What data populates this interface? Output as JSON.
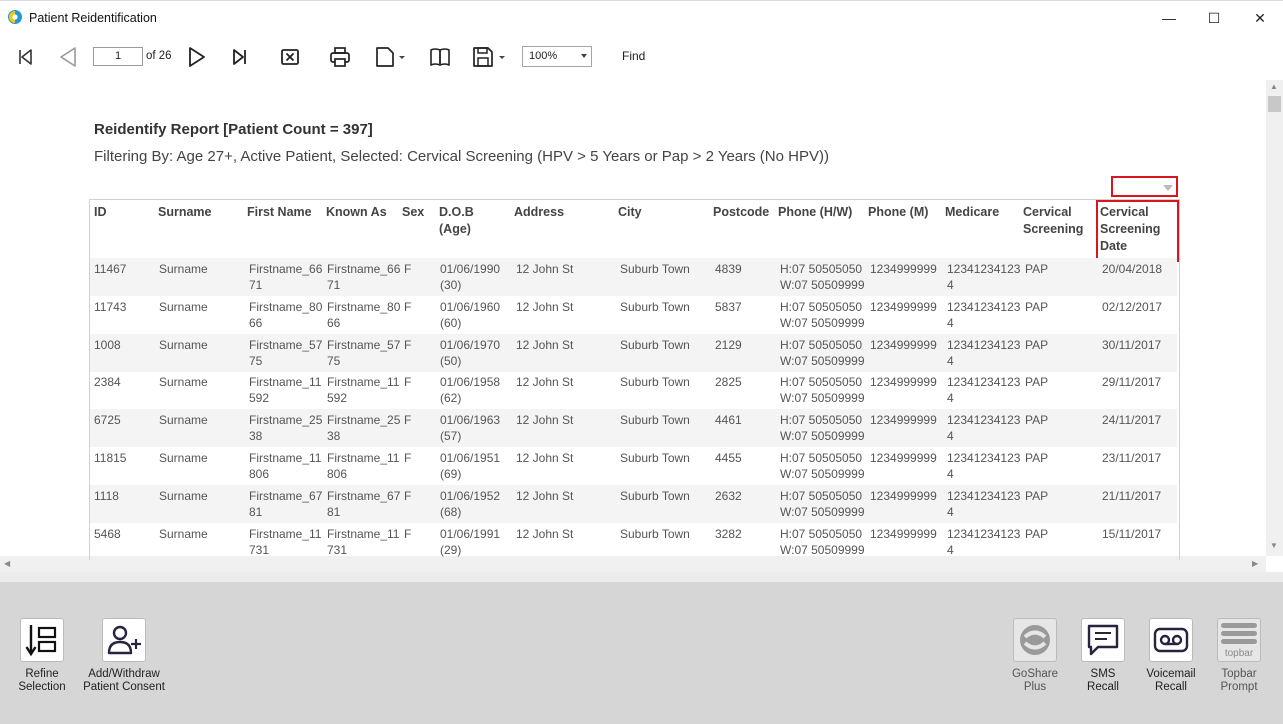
{
  "window": {
    "title": "Patient Reidentification",
    "minimize": "—",
    "maximize": "☐",
    "close": "✕"
  },
  "toolbar": {
    "page_value": "1",
    "page_of": "of 26",
    "zoom": "100%",
    "find": "Find"
  },
  "report": {
    "title": "Reidentify Report  [Patient Count = 397]",
    "filter": "Filtering By: Age 27+, Active Patient, Selected: Cervical Screening (HPV > 5 Years or Pap > 2 Years (No HPV))",
    "columns": {
      "id": "ID",
      "surname": "Surname",
      "first_name": "First Name",
      "known_as": "Known As",
      "sex": "Sex",
      "dob_1": "D.O.B",
      "dob_2": "(Age)",
      "address": "Address",
      "city": "City",
      "postcode": "Postcode",
      "phone_hw": "Phone (H/W)",
      "phone_m": "Phone (M)",
      "medicare": "Medicare",
      "cs_1": "Cervical",
      "cs_2": "Screening",
      "csd_1": "Cervical",
      "csd_2": "Screening",
      "csd_3": "Date"
    },
    "rows": [
      {
        "id": "11467",
        "surname": "Surname",
        "fn1": "Firstname_66",
        "fn2": "71",
        "ka1": "Firstname_66",
        "ka2": "71",
        "sex": "F",
        "dob": "01/06/1990",
        "age": "(30)",
        "address": "12 John St",
        "city": "Suburb Town",
        "postcode": "4839",
        "ph1": "H:07 50505050",
        "ph2": "W:07 50509999",
        "mobile": "1234999999",
        "med1": "12341234123",
        "med2": "4",
        "screening": "PAP",
        "date": "20/04/2018"
      },
      {
        "id": "11743",
        "surname": "Surname",
        "fn1": "Firstname_80",
        "fn2": "66",
        "ka1": "Firstname_80",
        "ka2": "66",
        "sex": "F",
        "dob": "01/06/1960",
        "age": "(60)",
        "address": "12 John St",
        "city": "Suburb Town",
        "postcode": "5837",
        "ph1": "H:07 50505050",
        "ph2": "W:07 50509999",
        "mobile": "1234999999",
        "med1": "12341234123",
        "med2": "4",
        "screening": "PAP",
        "date": "02/12/2017"
      },
      {
        "id": "1008",
        "surname": "Surname",
        "fn1": "Firstname_57",
        "fn2": "75",
        "ka1": "Firstname_57",
        "ka2": "75",
        "sex": "F",
        "dob": "01/06/1970",
        "age": "(50)",
        "address": "12 John St",
        "city": "Suburb Town",
        "postcode": "2129",
        "ph1": "H:07 50505050",
        "ph2": "W:07 50509999",
        "mobile": "1234999999",
        "med1": "12341234123",
        "med2": "4",
        "screening": "PAP",
        "date": "30/11/2017"
      },
      {
        "id": "2384",
        "surname": "Surname",
        "fn1": "Firstname_11",
        "fn2": "592",
        "ka1": "Firstname_11",
        "ka2": "592",
        "sex": "F",
        "dob": "01/06/1958",
        "age": "(62)",
        "address": "12 John St",
        "city": "Suburb Town",
        "postcode": "2825",
        "ph1": "H:07 50505050",
        "ph2": "W:07 50509999",
        "mobile": "1234999999",
        "med1": "12341234123",
        "med2": "4",
        "screening": "PAP",
        "date": "29/11/2017"
      },
      {
        "id": "6725",
        "surname": "Surname",
        "fn1": "Firstname_25",
        "fn2": "38",
        "ka1": "Firstname_25",
        "ka2": "38",
        "sex": "F",
        "dob": "01/06/1963",
        "age": "(57)",
        "address": "12 John St",
        "city": "Suburb Town",
        "postcode": "4461",
        "ph1": "H:07 50505050",
        "ph2": "W:07 50509999",
        "mobile": "1234999999",
        "med1": "12341234123",
        "med2": "4",
        "screening": "PAP",
        "date": "24/11/2017"
      },
      {
        "id": "11815",
        "surname": "Surname",
        "fn1": "Firstname_11",
        "fn2": "806",
        "ka1": "Firstname_11",
        "ka2": "806",
        "sex": "F",
        "dob": "01/06/1951",
        "age": "(69)",
        "address": "12 John St",
        "city": "Suburb Town",
        "postcode": "4455",
        "ph1": "H:07 50505050",
        "ph2": "W:07 50509999",
        "mobile": "1234999999",
        "med1": "12341234123",
        "med2": "4",
        "screening": "PAP",
        "date": "23/11/2017"
      },
      {
        "id": "1118",
        "surname": "Surname",
        "fn1": "Firstname_67",
        "fn2": "81",
        "ka1": "Firstname_67",
        "ka2": "81",
        "sex": "F",
        "dob": "01/06/1952",
        "age": "(68)",
        "address": "12 John St",
        "city": "Suburb Town",
        "postcode": "2632",
        "ph1": "H:07 50505050",
        "ph2": "W:07 50509999",
        "mobile": "1234999999",
        "med1": "12341234123",
        "med2": "4",
        "screening": "PAP",
        "date": "21/11/2017"
      },
      {
        "id": "5468",
        "surname": "Surname",
        "fn1": "Firstname_11",
        "fn2": "731",
        "ka1": "Firstname_11",
        "ka2": "731",
        "sex": "F",
        "dob": "01/06/1991",
        "age": "(29)",
        "address": "12 John St",
        "city": "Suburb Town",
        "postcode": "3282",
        "ph1": "H:07 50505050",
        "ph2": "W:07 50509999",
        "mobile": "1234999999",
        "med1": "12341234123",
        "med2": "4",
        "screening": "PAP",
        "date": "15/11/2017"
      }
    ]
  },
  "bottom": {
    "refine_1": "Refine",
    "refine_2": "Selection",
    "consent_1": "Add/Withdraw",
    "consent_2": "Patient Consent",
    "goshare_1": "GoShare",
    "goshare_2": "Plus",
    "sms_1": "SMS",
    "sms_2": "Recall",
    "voicemail_1": "Voicemail",
    "voicemail_2": "Recall",
    "topbar_1": "Topbar",
    "topbar_2": "Prompt",
    "topbar_logo": "topbar"
  },
  "colors": {
    "highlight": "#d8161e",
    "panel": "#d6d6d6",
    "row_alt": "#f4f4f4"
  }
}
